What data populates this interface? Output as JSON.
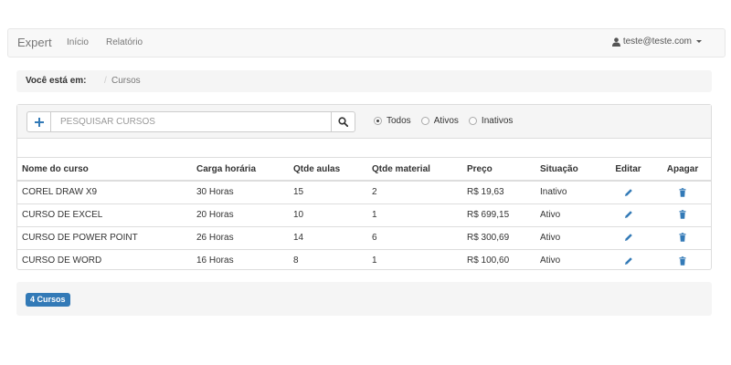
{
  "navbar": {
    "brand": "Expert",
    "links": [
      "Início",
      "Relatório"
    ],
    "user_email": "teste@teste.com"
  },
  "breadcrumb": {
    "label": "Você está em:",
    "separator": "/",
    "current": "Cursos"
  },
  "search": {
    "placeholder": "PESQUISAR CURSOS",
    "value": ""
  },
  "filter": {
    "options": [
      "Todos",
      "Ativos",
      "Inativos"
    ],
    "selected": "Todos"
  },
  "table": {
    "headers": [
      "Nome do curso",
      "Carga horária",
      "Qtde aulas",
      "Qtde material",
      "Preço",
      "Situação",
      "Editar",
      "Apagar"
    ],
    "rows": [
      [
        "COREL DRAW X9",
        "30 Horas",
        "15",
        "2",
        "R$ 19,63",
        "Inativo"
      ],
      [
        "CURSO DE EXCEL",
        "20 Horas",
        "10",
        "1",
        "R$ 699,15",
        "Ativo"
      ],
      [
        "CURSO DE POWER POINT",
        "26 Horas",
        "14",
        "6",
        "R$ 300,69",
        "Ativo"
      ],
      [
        "CURSO DE WORD",
        "16 Horas",
        "8",
        "1",
        "R$ 100,60",
        "Ativo"
      ]
    ]
  },
  "footer": {
    "count_label": "4 Cursos"
  },
  "icons": {
    "add": "plus-icon",
    "search": "search-icon",
    "user": "user-icon",
    "edit": "pencil-icon",
    "delete": "trash-icon"
  },
  "colors": {
    "primary": "#337ab7",
    "navbar_bg": "#f8f8f8",
    "well_bg": "#f5f5f5",
    "border": "#dddddd"
  }
}
